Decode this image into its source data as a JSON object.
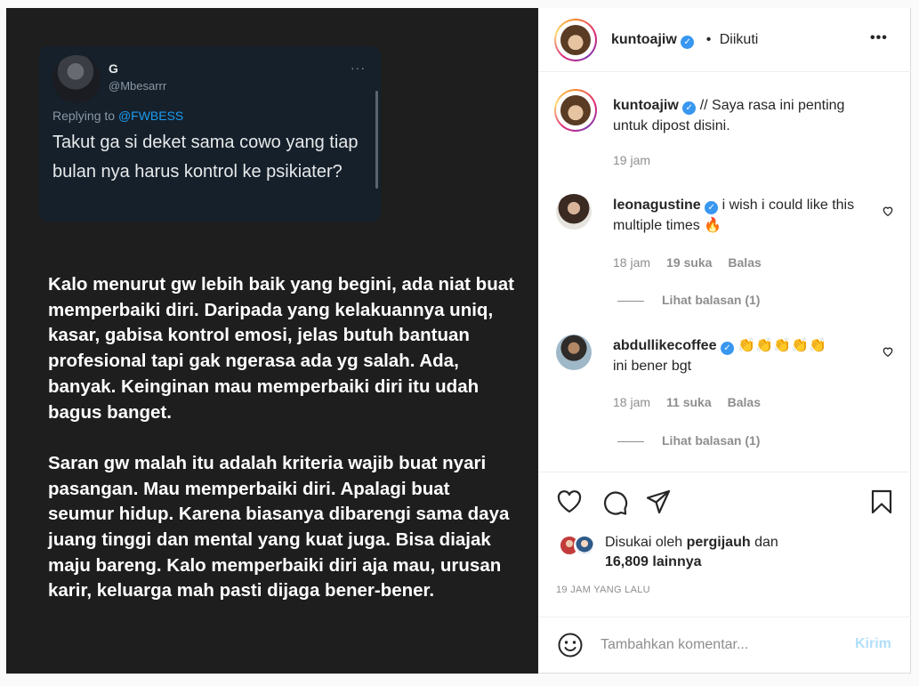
{
  "post_image": {
    "tweet": {
      "name": "G",
      "handle": "@Mbesarrr",
      "more": "···",
      "replying_prefix": "Replying to ",
      "replying_mention": "@FWBESS",
      "text": "Takut ga si deket sama cowo yang tiap bulan nya harus kontrol ke psikiater?"
    },
    "paragraphs": [
      "Kalo menurut gw lebih baik yang begini, ada niat buat memperbaiki diri. Daripada yang kelakuannya uniq, kasar, gabisa kontrol emosi, jelas butuh bantuan profesional tapi gak ngerasa ada yg salah. Ada, banyak. Keinginan mau memperbaiki diri itu udah bagus banget.",
      "Saran gw malah itu adalah kriteria wajib buat nyari pasangan. Mau memperbaiki diri. Apalagi buat seumur hidup. Karena biasanya dibarengi sama daya juang tinggi dan mental yang kuat juga. Bisa diajak maju bareng. Kalo memperbaiki diri aja mau, urusan karir, keluarga mah pasti dijaga bener-bener."
    ]
  },
  "header": {
    "username": "kuntoajiw",
    "separator": "•",
    "follow_status": "Diikuti",
    "more": "•••"
  },
  "caption": {
    "username": "kuntoajiw",
    "text": "// Saya rasa ini penting untuk dipost disini.",
    "time": "19 jam"
  },
  "comments": [
    {
      "username": "leonagustine",
      "text": "i wish i could like this multiple times 🔥",
      "time": "18 jam",
      "likes": "19 suka",
      "reply": "Balas",
      "view_replies": "Lihat balasan (1)"
    },
    {
      "username": "abdullikecoffee",
      "text": "👏👏👏👏👏",
      "text_line2": "ini bener bgt",
      "time": "18 jam",
      "likes": "11 suka",
      "reply": "Balas",
      "view_replies": "Lihat balasan (1)"
    }
  ],
  "likes": {
    "prefix": "Disukai oleh ",
    "user": "pergijauh",
    "middle": " dan",
    "count": "16,809 lainnya"
  },
  "timestamp": "19 JAM YANG LALU",
  "add_comment": {
    "placeholder": "Tambahkan komentar...",
    "post_label": "Kirim"
  },
  "icons": {
    "verified": "verified-badge-icon",
    "like": "heart-icon",
    "comment": "comment-bubble-icon",
    "share": "paper-plane-icon",
    "save": "bookmark-icon",
    "emoji": "smiley-icon"
  },
  "colors": {
    "verified": "#3897f0",
    "post_button": "#b2dffc",
    "tweet_mention": "#1d9bf0",
    "post_background": "#1e1e1e",
    "tweet_background": "#15202b"
  }
}
